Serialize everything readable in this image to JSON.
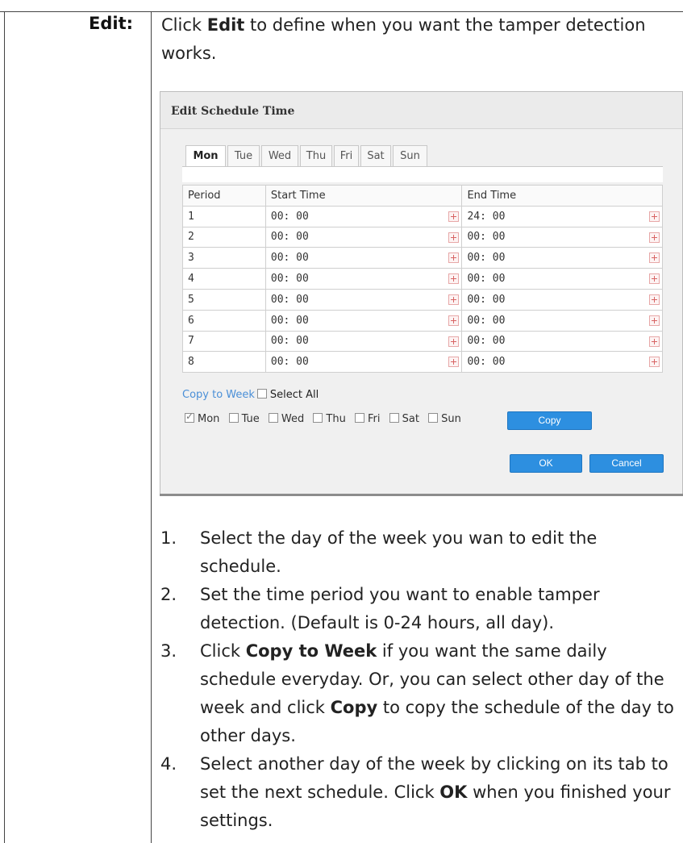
{
  "label": "Edit:",
  "intro": {
    "pre": "Click ",
    "bold": "Edit",
    "post": " to define when you want the tamper detection works."
  },
  "dialog": {
    "title": "Edit Schedule Time",
    "tabs": [
      "Mon",
      "Tue",
      "Wed",
      "Thu",
      "Fri",
      "Sat",
      "Sun"
    ],
    "active_tab": "Mon",
    "columns": [
      "Period",
      "Start Time",
      "End Time"
    ],
    "rows": [
      {
        "period": "1",
        "start": "00: 00",
        "end": "24: 00"
      },
      {
        "period": "2",
        "start": "00: 00",
        "end": "00: 00"
      },
      {
        "period": "3",
        "start": "00: 00",
        "end": "00: 00"
      },
      {
        "period": "4",
        "start": "00: 00",
        "end": "00: 00"
      },
      {
        "period": "5",
        "start": "00: 00",
        "end": "00: 00"
      },
      {
        "period": "6",
        "start": "00: 00",
        "end": "00: 00"
      },
      {
        "period": "7",
        "start": "00: 00",
        "end": "00: 00"
      },
      {
        "period": "8",
        "start": "00: 00",
        "end": "00: 00"
      }
    ],
    "copy_to_week": "Copy to Week",
    "select_all": "Select All",
    "days": [
      {
        "label": "Mon",
        "checked": true
      },
      {
        "label": "Tue",
        "checked": false
      },
      {
        "label": "Wed",
        "checked": false
      },
      {
        "label": "Thu",
        "checked": false
      },
      {
        "label": "Fri",
        "checked": false
      },
      {
        "label": "Sat",
        "checked": false
      },
      {
        "label": "Sun",
        "checked": false
      }
    ],
    "copy_button": "Copy",
    "ok_button": "OK",
    "cancel_button": "Cancel",
    "accent_color": "#2d8fe0",
    "link_color": "#4a8fd7"
  },
  "steps": [
    {
      "num": "1.",
      "parts": [
        {
          "t": "Select the day of the week you wan to edit the schedule."
        }
      ]
    },
    {
      "num": "2.",
      "parts": [
        {
          "t": "Set the time period you want to enable tamper detection. (Default is 0-24 hours, all day)."
        }
      ]
    },
    {
      "num": "3.",
      "parts": [
        {
          "t": "Click "
        },
        {
          "b": "Copy to Week"
        },
        {
          "t": " if you want the same daily schedule everyday. Or, you can select other day of the week and click "
        },
        {
          "b": "Copy"
        },
        {
          "t": " to copy the schedule of the day to other days."
        }
      ]
    },
    {
      "num": "4.",
      "parts": [
        {
          "t": "Select another day of the week by clicking on its tab to set the next schedule. Click "
        },
        {
          "b": "OK"
        },
        {
          "t": " when you finished your settings."
        }
      ]
    }
  ]
}
